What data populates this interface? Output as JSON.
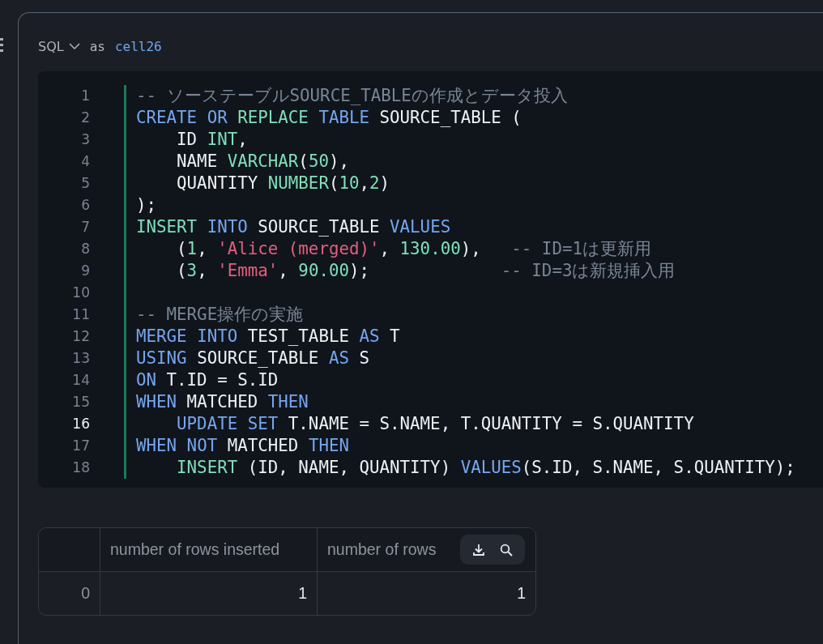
{
  "cell": {
    "language": "SQL",
    "as_label": "as",
    "name": "cell26"
  },
  "code": {
    "lines": [
      {
        "number": "1",
        "current": false,
        "tokens": [
          {
            "kind": "cmt",
            "t": "-- ソーステーブルSOURCE_TABLEの作成とデータ投入"
          }
        ]
      },
      {
        "number": "2",
        "current": false,
        "tokens": [
          {
            "kind": "kw",
            "t": "CREATE "
          },
          {
            "kind": "kw",
            "t": "OR "
          },
          {
            "kind": "ty",
            "t": "REPLACE "
          },
          {
            "kind": "kw",
            "t": "TABLE "
          },
          {
            "kind": "pl",
            "t": "SOURCE_TABLE ("
          }
        ]
      },
      {
        "number": "3",
        "current": false,
        "tokens": [
          {
            "kind": "pl",
            "t": "    ID "
          },
          {
            "kind": "ty",
            "t": "INT"
          },
          {
            "kind": "pl",
            "t": ","
          }
        ]
      },
      {
        "number": "4",
        "current": false,
        "tokens": [
          {
            "kind": "pl",
            "t": "    NAME "
          },
          {
            "kind": "ty",
            "t": "VARCHAR"
          },
          {
            "kind": "pl",
            "t": "("
          },
          {
            "kind": "num",
            "t": "50"
          },
          {
            "kind": "pl",
            "t": "),"
          }
        ]
      },
      {
        "number": "5",
        "current": false,
        "tokens": [
          {
            "kind": "pl",
            "t": "    QUANTITY "
          },
          {
            "kind": "ty",
            "t": "NUMBER"
          },
          {
            "kind": "pl",
            "t": "("
          },
          {
            "kind": "num",
            "t": "10"
          },
          {
            "kind": "pl",
            "t": ","
          },
          {
            "kind": "num",
            "t": "2"
          },
          {
            "kind": "pl",
            "t": ")"
          }
        ]
      },
      {
        "number": "6",
        "current": false,
        "tokens": [
          {
            "kind": "pl",
            "t": ");"
          }
        ]
      },
      {
        "number": "7",
        "current": false,
        "tokens": [
          {
            "kind": "ty",
            "t": "INSERT "
          },
          {
            "kind": "kw",
            "t": "INTO "
          },
          {
            "kind": "pl",
            "t": "SOURCE_TABLE "
          },
          {
            "kind": "kw",
            "t": "VALUES"
          }
        ]
      },
      {
        "number": "8",
        "current": false,
        "tokens": [
          {
            "kind": "pl",
            "t": "    ("
          },
          {
            "kind": "num",
            "t": "1"
          },
          {
            "kind": "pl",
            "t": ", "
          },
          {
            "kind": "str",
            "t": "'Alice (merged)'"
          },
          {
            "kind": "pl",
            "t": ", "
          },
          {
            "kind": "num",
            "t": "130.00"
          },
          {
            "kind": "pl",
            "t": "),   "
          },
          {
            "kind": "cmt",
            "t": "-- ID=1は更新用"
          }
        ]
      },
      {
        "number": "9",
        "current": false,
        "tokens": [
          {
            "kind": "pl",
            "t": "    ("
          },
          {
            "kind": "num",
            "t": "3"
          },
          {
            "kind": "pl",
            "t": ", "
          },
          {
            "kind": "str",
            "t": "'Emma'"
          },
          {
            "kind": "pl",
            "t": ", "
          },
          {
            "kind": "num",
            "t": "90.00"
          },
          {
            "kind": "pl",
            "t": ");             "
          },
          {
            "kind": "cmt",
            "t": "-- ID=3は新規挿入用"
          }
        ]
      },
      {
        "number": "10",
        "current": false
      },
      {
        "number": "11",
        "current": false,
        "tokens": [
          {
            "kind": "cmt",
            "t": "-- MERGE操作の実施"
          }
        ]
      },
      {
        "number": "12",
        "current": false,
        "tokens": [
          {
            "kind": "kw",
            "t": "MERGE "
          },
          {
            "kind": "kw",
            "t": "INTO "
          },
          {
            "kind": "pl",
            "t": "TEST_TABLE "
          },
          {
            "kind": "kw",
            "t": "AS "
          },
          {
            "kind": "pl",
            "t": "T"
          }
        ]
      },
      {
        "number": "13",
        "current": false,
        "tokens": [
          {
            "kind": "kw",
            "t": "USING "
          },
          {
            "kind": "pl",
            "t": "SOURCE_TABLE "
          },
          {
            "kind": "kw",
            "t": "AS "
          },
          {
            "kind": "pl",
            "t": "S"
          }
        ]
      },
      {
        "number": "14",
        "current": false,
        "tokens": [
          {
            "kind": "kw",
            "t": "ON "
          },
          {
            "kind": "pl",
            "t": "T.ID = S.ID"
          }
        ]
      },
      {
        "number": "15",
        "current": false,
        "tokens": [
          {
            "kind": "kw",
            "t": "WHEN "
          },
          {
            "kind": "pl",
            "t": "MATCHED "
          },
          {
            "kind": "kw",
            "t": "THEN"
          }
        ]
      },
      {
        "number": "16",
        "current": true,
        "tokens": [
          {
            "kind": "kw",
            "t": "    UPDATE "
          },
          {
            "kind": "kw",
            "t": "SET "
          },
          {
            "kind": "pl",
            "t": "T.NAME = S.NAME, T.QUANTITY = S.QUANTITY"
          }
        ]
      },
      {
        "number": "17",
        "current": false,
        "tokens": [
          {
            "kind": "kw",
            "t": "WHEN "
          },
          {
            "kind": "kw",
            "t": "NOT "
          },
          {
            "kind": "pl",
            "t": "MATCHED "
          },
          {
            "kind": "kw",
            "t": "THEN"
          }
        ]
      },
      {
        "number": "18",
        "current": false,
        "tokens": [
          {
            "kind": "ty",
            "t": "    INSERT "
          },
          {
            "kind": "pl",
            "t": "(ID, NAME, QUANTITY) "
          },
          {
            "kind": "kw",
            "t": "VALUES"
          },
          {
            "kind": "pl",
            "t": "(S.ID, S.NAME, S.QUANTITY);"
          }
        ]
      }
    ]
  },
  "table": {
    "columns": [
      "number of rows inserted",
      "number of rows"
    ],
    "rows": [
      {
        "index": "0",
        "cells": [
          "1",
          "1"
        ]
      }
    ]
  }
}
